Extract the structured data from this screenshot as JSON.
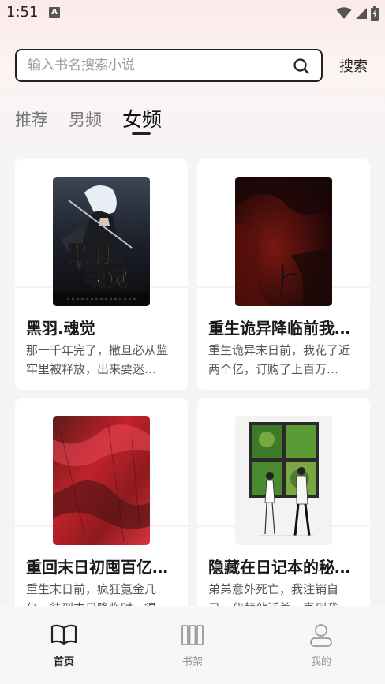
{
  "status_bar": {
    "time": "1:51",
    "notification_letter": "A"
  },
  "search": {
    "placeholder": "输入书名搜索小说",
    "button_label": "搜索"
  },
  "tabs": [
    {
      "label": "推荐",
      "active": false
    },
    {
      "label": "男频",
      "active": false
    },
    {
      "label": "女频",
      "active": true
    }
  ],
  "books": [
    {
      "title": "黑羽.魂觉",
      "description": "那一千年完了，撒旦必从监牢里被释放，出来要迷…",
      "cover_overlay_text": "黑羽.魂觉"
    },
    {
      "title": "重生诡异降临前我…",
      "description": "重生诡异末日前，我花了近两个亿，订购了上百万…"
    },
    {
      "title": "重回末日初囤百亿…",
      "description": "重生末日前，疯狂氪金几亿，待到末日降临时，得…"
    },
    {
      "title": "隐藏在日记本的秘…",
      "description": "弟弟意外死亡，我注销自己，代替他活着，直到我…"
    }
  ],
  "bottom_nav": [
    {
      "label": "首页",
      "icon": "book-open-icon",
      "active": true
    },
    {
      "label": "书架",
      "icon": "bookshelf-icon",
      "active": false
    },
    {
      "label": "我的",
      "icon": "user-icon",
      "active": false
    }
  ],
  "colors": {
    "accent": "#222222",
    "background_top": "#fbe9ea",
    "nav_background": "#f7f7f7"
  }
}
